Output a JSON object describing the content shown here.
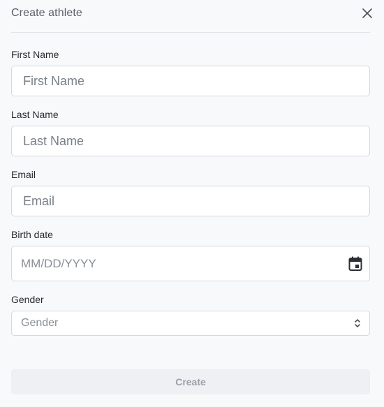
{
  "dialog": {
    "title": "Create athlete",
    "close_icon": "close-icon"
  },
  "fields": {
    "first_name": {
      "label": "First Name",
      "placeholder": "First Name",
      "value": ""
    },
    "last_name": {
      "label": "Last Name",
      "placeholder": "Last Name",
      "value": ""
    },
    "email": {
      "label": "Email",
      "placeholder": "Email",
      "value": ""
    },
    "birth_date": {
      "label": "Birth date",
      "placeholder": "MM/DD/YYYY",
      "icon": "calendar-icon"
    },
    "gender": {
      "label": "Gender",
      "placeholder": "Gender",
      "icon": "chevron-up-down-icon"
    }
  },
  "actions": {
    "create_label": "Create"
  },
  "colors": {
    "background": "#f8f9fb",
    "border": "#d5d8dd",
    "disabled_button": "#eef0f3"
  }
}
